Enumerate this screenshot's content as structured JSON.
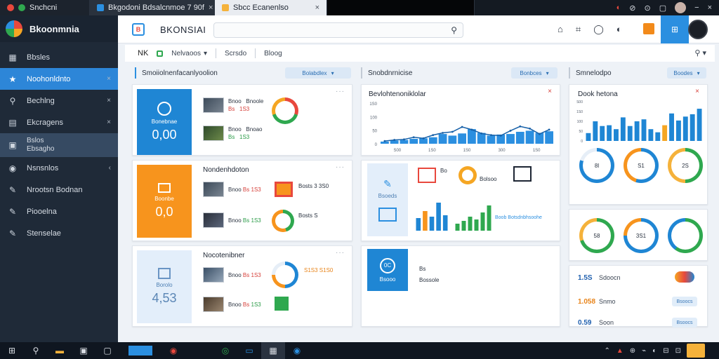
{
  "browser": {
    "tabs": [
      {
        "label": "Snchcni",
        "color": "#2fa84f"
      },
      {
        "label": "Bkgodoni Bdsalcnmoe 7 90f",
        "color": "#2b8fe0"
      },
      {
        "label": "Sbcc Ecanenlso",
        "color": "#f5b23b"
      },
      {
        "label": "",
        "color": "#000000"
      }
    ],
    "tab_close": "×",
    "window_controls": [
      "◐",
      "⊘",
      "⊙",
      "▢",
      "−",
      "×"
    ]
  },
  "sidebar": {
    "brand": "Bkoonmnia",
    "items": [
      {
        "icon": "▦",
        "label": "Bbsles",
        "close": ""
      },
      {
        "icon": "★",
        "label": "Noohonldnto",
        "close": "×"
      },
      {
        "icon": "⚲",
        "label": "Bechlng",
        "close": "×"
      },
      {
        "icon": "▤",
        "label": "Ekcragens",
        "close": "×"
      },
      {
        "icon": "▣",
        "label": "Bslos",
        "label2": "Ebsagho",
        "close": ""
      },
      {
        "icon": "◉",
        "label": "Nsnsnlos",
        "close": "‹"
      },
      {
        "icon": "✎",
        "label": "Nrootsn Bodnan",
        "close": ""
      },
      {
        "icon": "✎",
        "label": "Piooelna",
        "close": ""
      },
      {
        "icon": "✎",
        "label": "Stenselae",
        "close": ""
      }
    ]
  },
  "header": {
    "logo_letter": "B",
    "title": "BKONSIAI",
    "search_placeholder": "",
    "search_icon": "⚲",
    "icons": [
      "⌂",
      "⌗",
      "◯",
      "◐"
    ],
    "blue_button_icon": "⊞"
  },
  "toolbar": {
    "nk": "NK",
    "items": [
      "Nelvaoos",
      "Scrsdo",
      "Bloog"
    ],
    "dropdown": "▾",
    "right_icon": "⚲ ▾"
  },
  "sections": {
    "left": {
      "title": "Smoiiolnenfacanlyoolion",
      "pill": "Bolabdlex"
    },
    "middle": {
      "title": "Snobdnrnicise",
      "pill": "Bonbces"
    },
    "right": {
      "title": "Smnelodpo",
      "pill": "Boodes"
    }
  },
  "card1": {
    "tile_label": "Bonebnae",
    "tile_value": "0,00",
    "rows": [
      {
        "l1": "Bnoo",
        "l2": "Bnoole",
        "v1": "Bs",
        "v2": "1S3"
      },
      {
        "l1": "Bnoo",
        "l2": "Bnoao",
        "v1": "Bs",
        "v2": "1S3"
      }
    ],
    "dots": "···"
  },
  "card2": {
    "title": "Nondenhdoton",
    "tile_label": "Boonbe",
    "tile_value": "0,0",
    "rows": [
      {
        "l1": "Bnoo",
        "l2": "Bs",
        "v2": "1S3"
      },
      {
        "l1": "Bnoo",
        "l2": "Bs",
        "v2": "1S3"
      }
    ],
    "side": [
      "Bosts 3 3S0",
      "Bosts S"
    ],
    "dots": "···"
  },
  "card3": {
    "title": "Nocotenibner",
    "tile_label": "Borolo",
    "tile_value": "4,53",
    "rows": [
      {
        "l1": "Bnoo",
        "l2": "Bs",
        "v2": "1S3"
      },
      {
        "l1": "Bnoo",
        "l2": "Bs",
        "v2": "1S3"
      }
    ],
    "side": "S1S3 S1S0",
    "dots": "···"
  },
  "mid_card1": {
    "title": "Bevlohtenoniklolar",
    "close": "×"
  },
  "mid_card2": {
    "tile_label": "Bsoeds",
    "items": [
      "Bo",
      "Bolsoo"
    ],
    "bar_label": "Boob Botsdnbhsoohe"
  },
  "mid_card3": {
    "tile_label": "Bsooo",
    "tile_icon": "0C",
    "side": [
      "Bs",
      "Bossole"
    ]
  },
  "right_card1": {
    "title": "Dook hetona",
    "close": "×"
  },
  "right_card2": {
    "donuts": [
      {
        "label": "8l",
        "values": [
          0.8,
          0.2
        ],
        "colors": [
          "#1f86d4",
          "#e6eef7"
        ]
      },
      {
        "label": "S1",
        "values": [
          0.55,
          0.45
        ],
        "colors": [
          "#1f86d4",
          "#f7941d"
        ]
      },
      {
        "label": "2S",
        "values": [
          0.5,
          0.5
        ],
        "colors": [
          "#2fa84f",
          "#f5b23b"
        ]
      }
    ]
  },
  "right_card3": {
    "donuts": [
      {
        "label": "58",
        "values": [
          0.7,
          0.3
        ],
        "colors": [
          "#2fa84f",
          "#f5b23b"
        ]
      },
      {
        "label": "3S1",
        "values": [
          0.75,
          0.25
        ],
        "colors": [
          "#1f86d4",
          "#f7941d"
        ]
      },
      {
        "label": "",
        "values": [
          0.6,
          0.4
        ],
        "colors": [
          "#2fa84f",
          "#1f86d4"
        ]
      }
    ]
  },
  "right_card4": {
    "stats": [
      {
        "value": "1.5S",
        "text": "Sdoocn",
        "color": "#1f5fae",
        "btn": ""
      },
      {
        "value": "1.058",
        "text": "Snmo",
        "color": "#e8841a",
        "btn": "Bsoocs"
      },
      {
        "value": "0.59",
        "text": "Soon",
        "color": "#1f5fae",
        "btn": "Bsoocs"
      }
    ]
  },
  "taskbar": {
    "icons": [
      "⊞",
      "⚲",
      "▬",
      "▣",
      "▢",
      "",
      "◉",
      "",
      "◎",
      "▭",
      "▦",
      "◉"
    ],
    "tray": [
      "⌃",
      "▲",
      "⊕",
      "⌁",
      "◐",
      "⊟",
      "⊡"
    ]
  },
  "chart_data": [
    {
      "type": "bar",
      "id": "mid-bar-line",
      "title": "Bevlohtenoniklolar",
      "categories": [
        "",
        "",
        "",
        "",
        "",
        "",
        "",
        "",
        "",
        "",
        "",
        "",
        "",
        "",
        "",
        "",
        "",
        ""
      ],
      "series": [
        {
          "values": [
            8,
            12,
            14,
            18,
            20,
            24,
            36,
            30,
            38,
            54,
            40,
            30,
            34,
            36,
            44,
            48,
            40,
            46
          ]
        },
        {
          "values": [
            10,
            14,
            16,
            24,
            20,
            32,
            40,
            44,
            62,
            52,
            38,
            32,
            30,
            48,
            64,
            56,
            36,
            52
          ]
        }
      ],
      "xticks": [
        "S00",
        "1S0",
        "1S0",
        "300",
        "1S0"
      ],
      "yticks": [
        "0",
        "50",
        "100",
        "1S0"
      ],
      "ylim": [
        0,
        150
      ]
    },
    {
      "type": "bar",
      "id": "right-bar",
      "title": "Dook hetona",
      "categories": [
        "",
        "",
        "",
        "",
        "",
        "",
        "",
        "",
        "",
        "",
        "",
        "",
        "",
        "",
        "",
        "",
        ""
      ],
      "values": [
        20,
        50,
        38,
        40,
        30,
        60,
        38,
        50,
        55,
        30,
        22,
        40,
        70,
        52,
        62,
        68,
        82
      ],
      "colors": [
        "#1f86d4",
        "#1f86d4",
        "#1f86d4",
        "#1f86d4",
        "#1f86d4",
        "#1f86d4",
        "#1f86d4",
        "#1f86d4",
        "#1f86d4",
        "#1f86d4",
        "#1f86d4",
        "#f5a623",
        "#1f86d4",
        "#1f86d4",
        "#1f86d4",
        "#1f86d4",
        "#1f86d4"
      ],
      "yticks": [
        "0",
        "50",
        "100",
        "1S0",
        "S00"
      ],
      "ylim": [
        0,
        100
      ]
    },
    {
      "type": "bar",
      "id": "mid-small-bar-1",
      "values": [
        18,
        28,
        20,
        40,
        22
      ],
      "colors": [
        "#1f86d4",
        "#f7941d",
        "#1f86d4",
        "#1f86d4",
        "#1f86d4"
      ],
      "ylim": [
        0,
        40
      ]
    },
    {
      "type": "bar",
      "id": "mid-small-bar-2",
      "values": [
        10,
        14,
        20,
        16,
        26,
        36
      ],
      "colors": [
        "#2fa84f",
        "#2fa84f",
        "#2fa84f",
        "#2fa84f",
        "#2fa84f",
        "#2fa84f"
      ],
      "ylim": [
        0,
        40
      ]
    }
  ]
}
